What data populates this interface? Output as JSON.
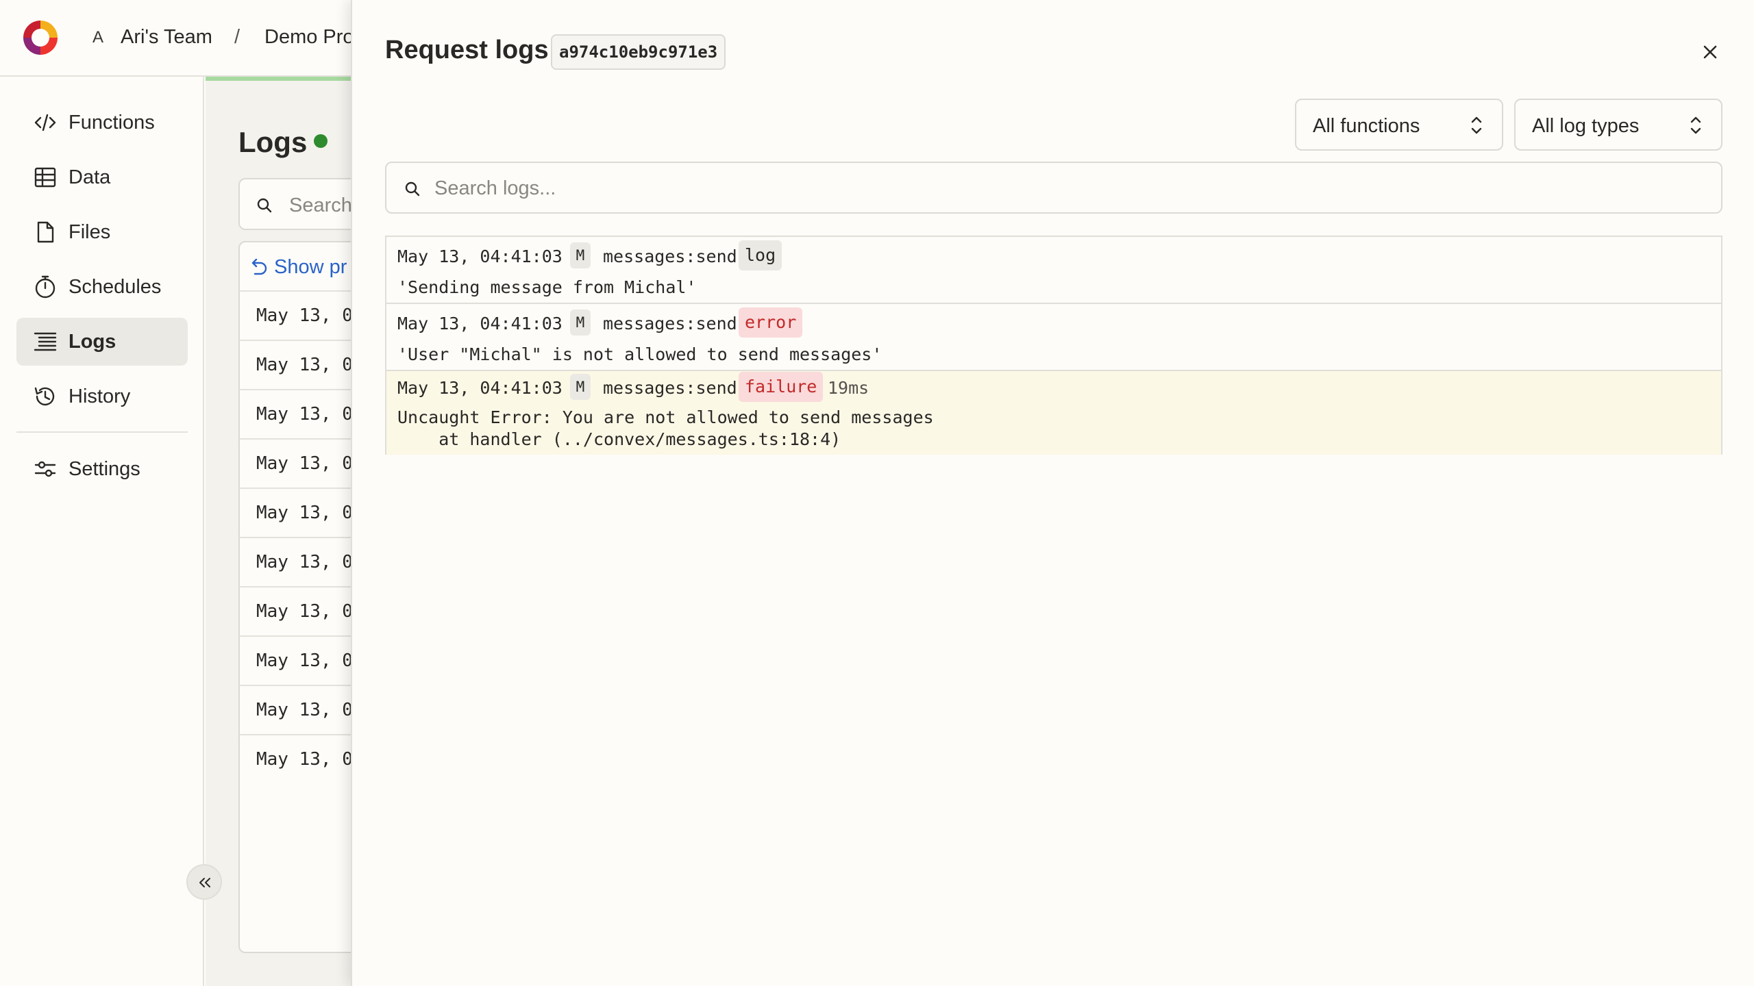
{
  "header": {
    "team_avatar": "A",
    "team_name": "Ari's Team",
    "separator": "/",
    "project_name": "Demo Pro"
  },
  "sidebar": {
    "items": [
      {
        "label": "Functions",
        "icon": "code-icon"
      },
      {
        "label": "Data",
        "icon": "table-icon"
      },
      {
        "label": "Files",
        "icon": "file-icon"
      },
      {
        "label": "Schedules",
        "icon": "stopwatch-icon"
      },
      {
        "label": "Logs",
        "icon": "list-icon",
        "active": true
      },
      {
        "label": "History",
        "icon": "history-icon"
      },
      {
        "label": "Settings",
        "icon": "sliders-icon"
      }
    ]
  },
  "main": {
    "title": "Logs",
    "search_placeholder": "Search",
    "show_previous_label": "Show pr",
    "rows": [
      "May 13, 04",
      "May 13, 04",
      "May 13, 04",
      "May 13, 04",
      "May 13, 04",
      "May 13, 04",
      "May 13, 04",
      "May 13, 04",
      "May 13, 04",
      "May 13, 04"
    ]
  },
  "panel": {
    "title": "Request logs",
    "request_id": "a974c10eb9c971e3",
    "filters": {
      "functions_label": "All functions",
      "log_types_label": "All log types"
    },
    "search_placeholder": "Search logs...",
    "entries": [
      {
        "timestamp": "May 13, 04:41:03",
        "udf_type": "M",
        "function": "messages:send",
        "type": "log",
        "message": "'Sending message from Michal'"
      },
      {
        "timestamp": "May 13, 04:41:03",
        "udf_type": "M",
        "function": "messages:send",
        "type": "error",
        "message": "'User \"Michal\" is not allowed to send messages'"
      },
      {
        "timestamp": "May 13, 04:41:03",
        "udf_type": "M",
        "function": "messages:send",
        "type": "failure",
        "duration": "19ms",
        "message_line1": "Uncaught Error: You are not allowed to send messages",
        "message_line2": "    at handler (../convex/messages.ts:18:4)"
      }
    ]
  },
  "colors": {
    "accent_link": "#2a62c9",
    "live": "#2e8b2e",
    "error_bg": "#fadada",
    "error_text": "#c22a2a",
    "failure_row_bg": "#fcf8e6"
  }
}
